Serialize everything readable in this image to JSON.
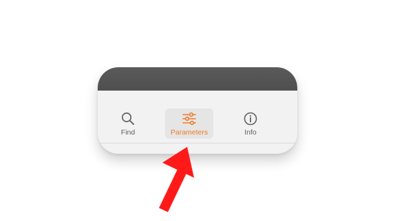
{
  "toolbar": {
    "tabs": [
      {
        "label": "Find",
        "icon": "search-icon",
        "selected": false
      },
      {
        "label": "Parameters",
        "icon": "sliders-icon",
        "selected": true
      },
      {
        "label": "Info",
        "icon": "info-icon",
        "selected": false
      }
    ]
  },
  "colors": {
    "accent": "#f07a2a",
    "annotation_arrow": "#ff1a1a",
    "header_dark": "#555555",
    "panel_bg": "#f2f2f2"
  }
}
